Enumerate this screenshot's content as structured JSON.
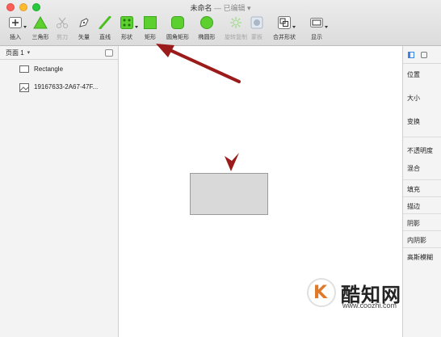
{
  "window": {
    "title": "未命名",
    "status": "— 已编辑",
    "has_dropdown": true
  },
  "toolbar": {
    "items": [
      {
        "label": "插入",
        "icon": "plus-icon",
        "enabled": true,
        "has_menu": true
      },
      {
        "label": "三角形",
        "icon": "triangle-icon",
        "enabled": true
      },
      {
        "label": "剪刀",
        "icon": "scissors-icon",
        "enabled": false
      },
      {
        "label": "矢量",
        "icon": "pen-icon",
        "enabled": true
      },
      {
        "label": "直线",
        "icon": "line-icon",
        "enabled": true
      },
      {
        "label": "形状",
        "icon": "shapes-icon",
        "enabled": true,
        "has_menu": true
      },
      {
        "label": "矩形",
        "icon": "rectangle-icon",
        "enabled": true
      },
      {
        "label": "圆角矩形",
        "icon": "rounded-rectangle-icon",
        "enabled": true
      },
      {
        "label": "椭圆形",
        "icon": "oval-icon",
        "enabled": true
      },
      {
        "label": "旋转复制",
        "icon": "rotate-copy-icon",
        "enabled": false
      },
      {
        "label": "蒙板",
        "icon": "mask-icon",
        "enabled": false
      },
      {
        "label": "合并形状",
        "icon": "combine-shapes-icon",
        "enabled": true,
        "has_menu": true
      },
      {
        "label": "显示",
        "icon": "view-icon",
        "enabled": true,
        "has_menu": true
      }
    ],
    "accent": "#5cd02f"
  },
  "layers_panel": {
    "page_label": "页面 1",
    "layers": [
      {
        "name": "Rectangle",
        "icon": "rectangle-layer-icon"
      },
      {
        "name": "19167633-2A67-47F...",
        "icon": "image-layer-icon"
      }
    ]
  },
  "inspector": {
    "sections": [
      "位置",
      "大小",
      "变换",
      "不透明度",
      "混合",
      "填充",
      "描边",
      "阴影",
      "内阴影",
      "高斯模糊"
    ]
  },
  "canvas": {
    "shape_fill": "#d9d9d9",
    "annotation_color": "#9b1b1b"
  },
  "watermark": {
    "mark": "K",
    "name": "酷知网",
    "url": "www.coozhi.com"
  }
}
